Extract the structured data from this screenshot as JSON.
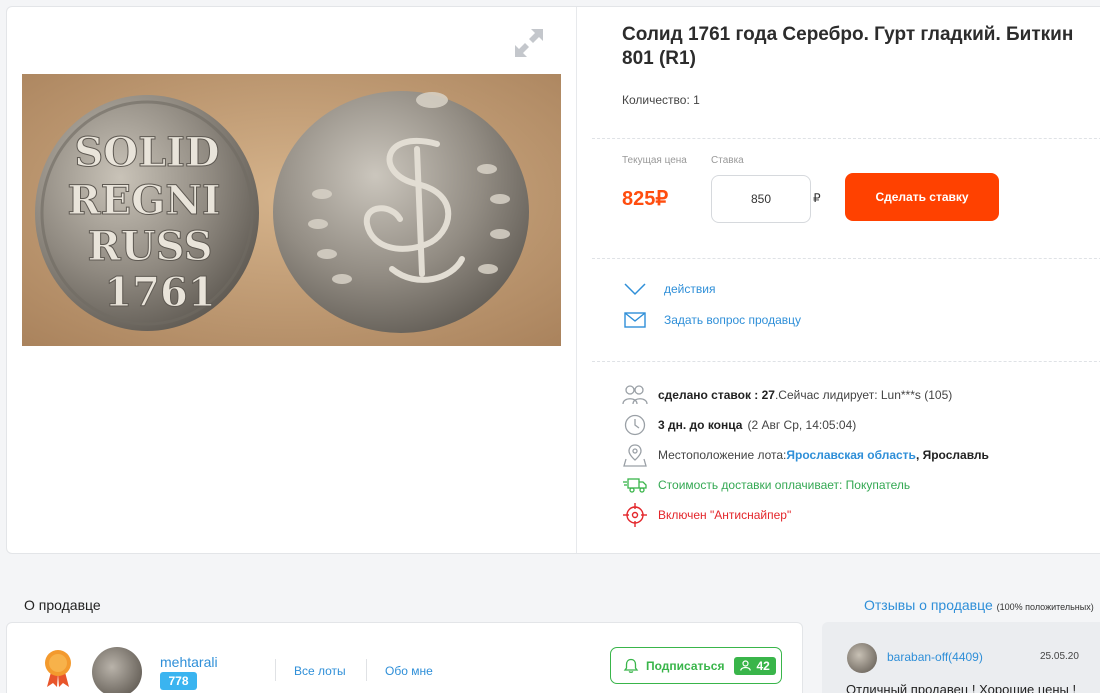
{
  "lot": {
    "title": "Солид 1761 года Серебро. Гурт гладкий. Биткин 801 (R1)",
    "quantity": "Количество: 1",
    "photo_alt": "Солид 1761 года"
  },
  "bid": {
    "current_price_label": "Текущая цена",
    "bid_label": "Ставка",
    "current_price": "825₽",
    "bid_value": "850",
    "bid_currency": "₽",
    "button_label": "Сделать ставку"
  },
  "actions": [
    {
      "label": "действия",
      "icon": "chevron-down-icon"
    },
    {
      "label": "Задать вопрос продавцу",
      "icon": "envelope-icon"
    }
  ],
  "meta": {
    "bids_count": "сделано ставок : 27",
    "leader_text": " .Сейчас лидирует: Lun***s (105)",
    "time_left": "3 дн. до конца",
    "end_time": "(2 Авг Ср, 14:05:04)",
    "location_label": "Местоположение лота:",
    "location_region": "Ярославская область",
    "location_city": ", Ярославль",
    "shipping": "Стоимость доставки оплачивает: Покупатель",
    "antisniper": "Включен \"Антиснайпер\""
  },
  "seller_section": {
    "title": "О продавце",
    "reviews_link": "Отзывы о продавце",
    "reviews_positive": "(100% положительных)"
  },
  "seller": {
    "name": "mehtarali",
    "rating": "778",
    "all_lots": "Все лоты",
    "about": "Обо мне",
    "subscribe_label": "Подписаться",
    "subscribers": "42"
  },
  "review": {
    "user": "baraban-off(4409)",
    "date": "25.05.20",
    "text": "Отличный продавец ! Хорошие цены !"
  },
  "colors": {
    "accent": "#ff4100",
    "price": "#ff4d0f",
    "link": "#2f8fd8",
    "green": "#39b54a",
    "rating_badge": "#3ab4f0",
    "antisniper": "#e3262b"
  }
}
